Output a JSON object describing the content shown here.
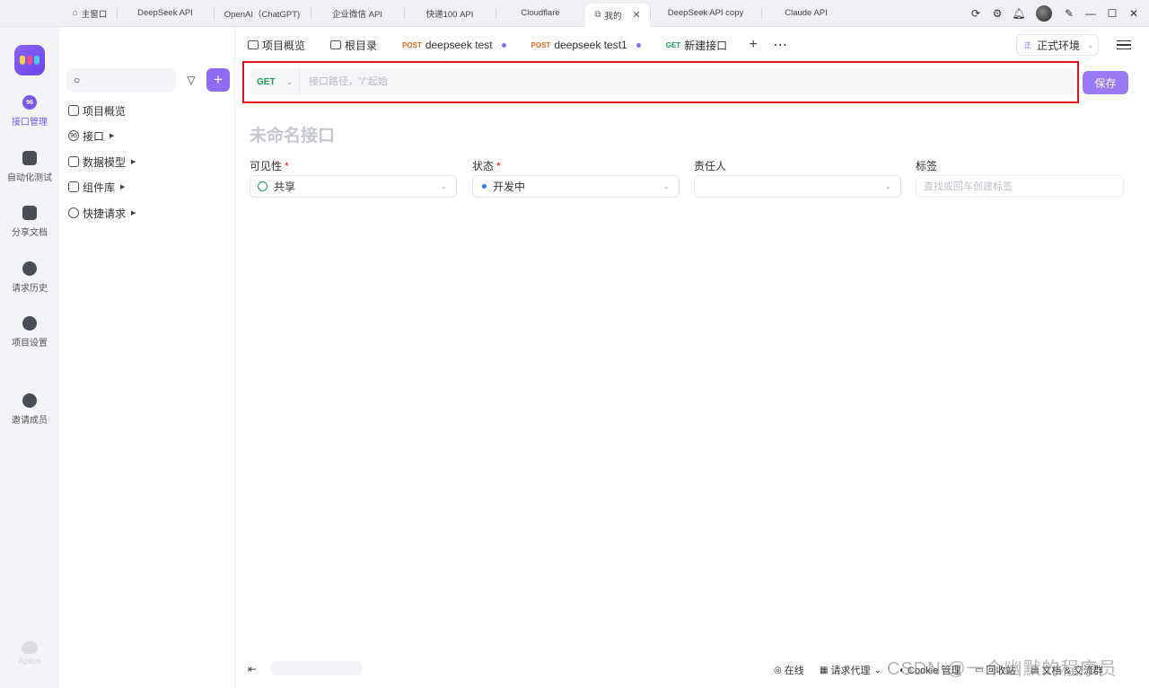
{
  "window_tabs": [
    {
      "label": "主窗口",
      "icon": "home-icon"
    },
    {
      "label": "DeepSeek API"
    },
    {
      "label": "OpenAI（ChatGPT)"
    },
    {
      "label": "企业微信 API"
    },
    {
      "label": "快递100 API"
    },
    {
      "label": "Cloudflare"
    },
    {
      "label": "我的",
      "active": true
    },
    {
      "label": "DeepSeek API copy"
    },
    {
      "label": "Claude API"
    }
  ],
  "rail": {
    "items": [
      {
        "label": "接口管理",
        "icon": "api-management-icon",
        "icon_text": "96",
        "active": true
      },
      {
        "label": "自动化测试",
        "icon": "automation-test-icon"
      },
      {
        "label": "分享文档",
        "icon": "share-docs-icon"
      },
      {
        "label": "请求历史",
        "icon": "history-clock-icon"
      },
      {
        "label": "项目设置",
        "icon": "settings-icon"
      },
      {
        "label": "邀请成员",
        "icon": "invite-member-icon"
      }
    ],
    "footer": "Apifox"
  },
  "tree": {
    "items": [
      {
        "label": "项目概览",
        "icon": "overview-icon",
        "caret": false
      },
      {
        "label": "接口",
        "icon": "api-icon",
        "icon_text": "96",
        "caret": true
      },
      {
        "label": "数据模型",
        "icon": "data-model-icon",
        "caret": true
      },
      {
        "label": "组件库",
        "icon": "components-icon",
        "caret": true
      },
      {
        "label": "快捷请求",
        "icon": "quick-request-icon",
        "caret": true
      }
    ]
  },
  "tabs": [
    {
      "label": "项目概览",
      "type": "overview"
    },
    {
      "label": "根目录",
      "type": "folder"
    },
    {
      "method": "POST",
      "label": "deepseek test",
      "dot": true
    },
    {
      "method": "POST",
      "label": "deepseek test1",
      "dot": true
    },
    {
      "method": "GET",
      "label": "新建接口",
      "active": true
    }
  ],
  "env": {
    "badge": "正",
    "label": "正式环境"
  },
  "request": {
    "method": "GET",
    "placeholder": "接口路径，\"/\"起始",
    "save_label": "保存"
  },
  "api_name_placeholder": "未命名接口",
  "fields": {
    "visibility": {
      "label": "可见性",
      "value": "共享"
    },
    "status": {
      "label": "状态",
      "value": "开发中"
    },
    "owner": {
      "label": "责任人",
      "value": ""
    },
    "tags": {
      "label": "标签",
      "placeholder": "查找或回车创建标签"
    }
  },
  "statusbar": {
    "online": "在线",
    "proxy": "请求代理",
    "cookie": "Cookie 管理",
    "recycle": "回收站",
    "docs": "文档 & 交流群"
  },
  "watermark": "CSDN @一个幽默的程序员"
}
